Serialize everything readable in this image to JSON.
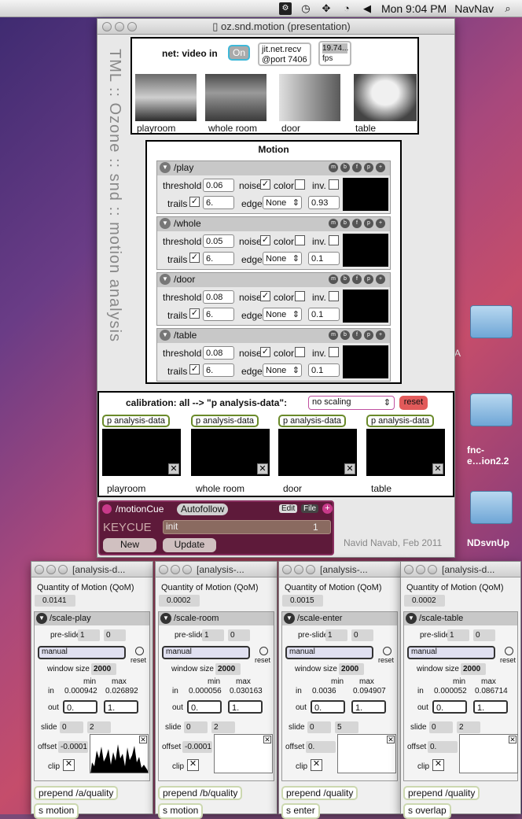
{
  "menubar": {
    "clock": "Mon 9:04 PM",
    "user": "NavNav"
  },
  "desktop": {
    "folder_labels": [
      "fnc-",
      "e…ion2.2",
      "NDsvnUp"
    ],
    "partial_letter": "A"
  },
  "main_window": {
    "title": "oz.snd.motion (presentation)",
    "vertical_title": "TML :: Ozone :: snd :: motion analysis",
    "net": {
      "label": "net: video in",
      "toggle": "On",
      "recv_line1": "jit.net.recv",
      "recv_line2": "@port 7406",
      "fps_value": "19.74...",
      "fps_label": "fps"
    },
    "cams": [
      {
        "label": "playroom"
      },
      {
        "label": "whole room"
      },
      {
        "label": "door"
      },
      {
        "label": "table"
      }
    ],
    "motion": {
      "title": "Motion",
      "param_labels": {
        "threshold": "threshold",
        "noise": "noise",
        "color": "color",
        "inv": "inv.",
        "trails": "trails",
        "edge": "edge"
      },
      "buttons": [
        "m",
        "b",
        "f",
        "p",
        "+"
      ],
      "sections": [
        {
          "name": "/play",
          "threshold": "0.06",
          "trails": "6.",
          "edge": "None",
          "edge_val": "0.93"
        },
        {
          "name": "/whole",
          "threshold": "0.05",
          "trails": "6.",
          "edge": "None",
          "edge_val": "0.1"
        },
        {
          "name": "/door",
          "threshold": "0.08",
          "trails": "6.",
          "edge": "None",
          "edge_val": "0.1"
        },
        {
          "name": "/table",
          "threshold": "0.08",
          "trails": "6.",
          "edge": "None",
          "edge_val": "0.1"
        }
      ]
    },
    "calibration": {
      "title": "calibration: all --> \"p analysis-data\":",
      "scaling": "no scaling",
      "reset": "reset",
      "items": [
        {
          "tag": "p analysis-data",
          "label": "playroom"
        },
        {
          "tag": "p analysis-data",
          "label": "whole room"
        },
        {
          "tag": "p analysis-data",
          "label": "door"
        },
        {
          "tag": "p analysis-data",
          "label": "table"
        }
      ]
    },
    "cue": {
      "name": "/motionCue",
      "autofollow": "Autofollow",
      "edit": "Edit",
      "file": "File",
      "keycue": "KEYCUE",
      "init": "init",
      "num": "1",
      "new_btn": "New",
      "update_btn": "Update"
    },
    "credit": "Navid Navab, Feb 2011"
  },
  "analysis": {
    "common": {
      "qom": "Quantity of Motion (QoM)",
      "preslide": "pre-slide",
      "manual": "manual",
      "reset": "reset",
      "window_size": "window size",
      "min": "min",
      "max": "max",
      "in": "in",
      "out": "out",
      "slide": "slide",
      "offset": "offset",
      "clip": "clip"
    },
    "windows": [
      {
        "title": "[analysis-d...",
        "qom": "0.0141",
        "section": "/scale-play",
        "pre1": "1",
        "pre2": "0",
        "ws": "2000",
        "min": "0.000942",
        "max": "0.026892",
        "out1": "0.",
        "out2": "1.",
        "slide1": "0",
        "slide2": "2",
        "offset": "-0.0001",
        "prepend": "prepend /a/quality",
        "send": "s motion"
      },
      {
        "title": "[analysis-...",
        "qom": "0.0002",
        "section": "/scale-room",
        "pre1": "1",
        "pre2": "0",
        "ws": "2000",
        "min": "0.000056",
        "max": "0.030163",
        "out1": "0.",
        "out2": "1.",
        "slide1": "0",
        "slide2": "2",
        "offset": "-0.0001",
        "prepend": "prepend /b/quality",
        "send": "s motion"
      },
      {
        "title": "[analysis-...",
        "qom": "0.0015",
        "section": "/scale-enter",
        "pre1": "1",
        "pre2": "0",
        "ws": "2000",
        "min": "0.0036",
        "max": "0.094907",
        "out1": "0.",
        "out2": "1.",
        "slide1": "0",
        "slide2": "5",
        "offset": "0.",
        "prepend": "prepend /quality",
        "send": "s enter"
      },
      {
        "title": "[analysis-d...",
        "qom": "0.0002",
        "section": "/scale-table",
        "pre1": "1",
        "pre2": "0",
        "ws": "2000",
        "min": "0.000052",
        "max": "0.086714",
        "out1": "0.",
        "out2": "1.",
        "slide1": "0",
        "slide2": "2",
        "offset": "0.",
        "prepend": "prepend /quality",
        "send": "s overlap"
      }
    ]
  }
}
